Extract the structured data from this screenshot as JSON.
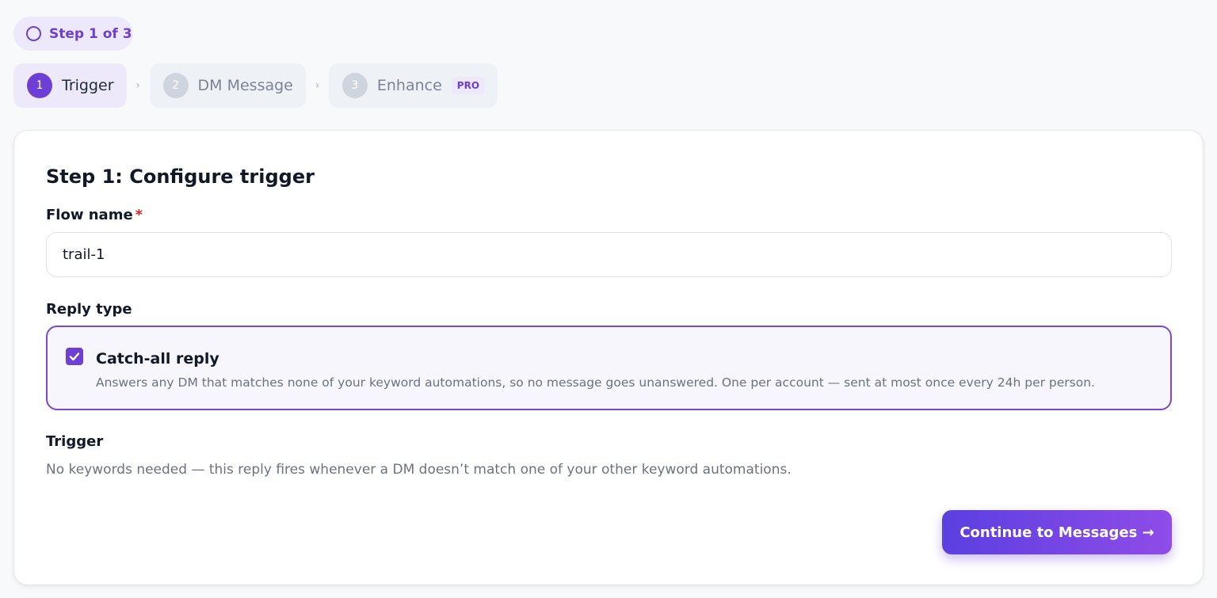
{
  "progress": {
    "badge_label": "Step 1 of 3"
  },
  "steps": [
    {
      "number": "1",
      "label": "Trigger",
      "state": "active"
    },
    {
      "number": "2",
      "label": "DM Message",
      "state": "inactive"
    },
    {
      "number": "3",
      "label": "Enhance",
      "state": "inactive",
      "badge": "PRO"
    }
  ],
  "step_separator": "›",
  "card": {
    "title": "Step 1: Configure trigger",
    "flow_name": {
      "label": "Flow name",
      "required_mark": "*",
      "value": "trail-1"
    },
    "reply_type": {
      "label": "Reply type",
      "option": {
        "title": "Catch-all reply",
        "checked": true,
        "description": "Answers any DM that matches none of your keyword automations, so no message goes unanswered. One per account — sent at most once every 24h per person."
      }
    },
    "trigger": {
      "label": "Trigger",
      "description": "No keywords needed — this reply fires whenever a DM doesn’t match one of your other keyword automations."
    },
    "continue_button": "Continue to Messages →"
  },
  "colors": {
    "accent": "#6d3fd4",
    "accent_light": "#ede9fb",
    "required": "#dc2626",
    "button_gradient_start": "#5b3fe0",
    "button_gradient_end": "#8f4ce8"
  },
  "icons": {
    "progress": "ring-icon",
    "checkbox": "check-icon",
    "separator": "chevron-right-icon"
  }
}
